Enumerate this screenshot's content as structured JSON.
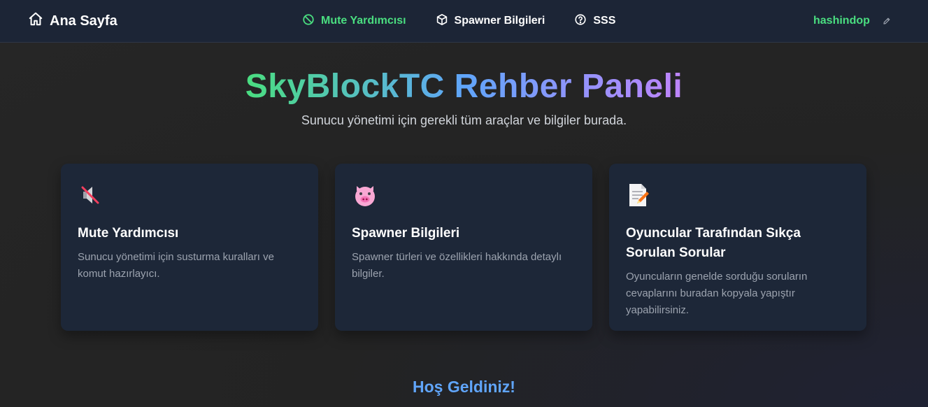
{
  "nav": {
    "home_label": "Ana Sayfa",
    "links": [
      {
        "label": "Mute Yardımcısı",
        "icon": "ban-icon",
        "active": true
      },
      {
        "label": "Spawner Bilgileri",
        "icon": "cube-icon",
        "active": false
      },
      {
        "label": "SSS",
        "icon": "question-circle-icon",
        "active": false
      }
    ],
    "username": "hashindop"
  },
  "hero": {
    "title": "SkyBlockTC Rehber Paneli",
    "subtitle": "Sunucu yönetimi için gerekli tüm araçlar ve bilgiler burada."
  },
  "cards": [
    {
      "icon": "muted-speaker-icon",
      "title": "Mute Yardımcısı",
      "description": "Sunucu yönetimi için susturma kuralları ve komut hazırlayıcı."
    },
    {
      "icon": "pig-face-icon",
      "title": "Spawner Bilgileri",
      "description": "Spawner türleri ve özellikleri hakkında detaylı bilgiler."
    },
    {
      "icon": "memo-icon",
      "title": "Oyuncular Tarafından Sıkça Sorulan Sorular",
      "description": "Oyuncuların genelde sorduğu soruların cevaplarını buradan kopyala yapıştır yapabilirsiniz."
    }
  ],
  "welcome": "Hoş Geldiniz!",
  "colors": {
    "accent_green": "#4ade80",
    "accent_blue": "#60a5fa",
    "accent_purple": "#c084fc",
    "navbar_bg": "#1c2536",
    "card_bg": "#1d2738"
  }
}
